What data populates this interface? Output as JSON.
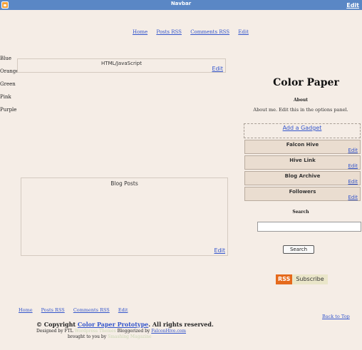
{
  "navbar": {
    "title": "Navbar",
    "edit_label": "Edit"
  },
  "top_nav": {
    "home": "Home",
    "posts_rss": "Posts RSS",
    "comments_rss": "Comments RSS",
    "edit": "Edit"
  },
  "colors": [
    "Blue",
    "Orange",
    "Green",
    "Pink",
    "Purple"
  ],
  "html_widget": {
    "title": "HTML/JavaScript",
    "edit": "Edit"
  },
  "blog_posts_widget": {
    "title": "Blog Posts",
    "edit": "Edit"
  },
  "sidebar": {
    "blog_title": "Color Paper",
    "about_heading": "About",
    "about_text": "About me. Edit this in the options panel.",
    "add_gadget": "Add a Gadget",
    "widgets": [
      {
        "title": "Falcon Hive",
        "edit": "Edit"
      },
      {
        "title": "Hive Link",
        "edit": "Edit"
      },
      {
        "title": "Blog Archive",
        "edit": "Edit"
      },
      {
        "title": "Followers",
        "edit": "Edit"
      }
    ],
    "search_heading": "Search",
    "search_value": "",
    "search_button": "Search",
    "rss_label": "RSS",
    "subscribe_label": "Subscribe"
  },
  "footer": {
    "nav": {
      "home": "Home",
      "posts_rss": "Posts RSS",
      "comments_rss": "Comments RSS",
      "edit": "Edit"
    },
    "back_to_top": "Back to Top",
    "copyright_prefix": "© Copyright ",
    "copyright_link": "Color Paper Prototype",
    "copyright_suffix": ". All rights reserved.",
    "designed_by": "Designed by FTL",
    "designed_faded": "Wordpress Themes",
    "bloggerized_by": "Bloggerized by",
    "bloggerized_link": "FalconHive.com",
    "brought_prefix": "brought to you by",
    "brought_faded": "Smashing Magazine"
  },
  "colors_palette": {
    "navbar": "#5a87c5",
    "background": "#f5ede6",
    "widget_bg": "#eaddd0",
    "rss": "#e56a1c"
  }
}
